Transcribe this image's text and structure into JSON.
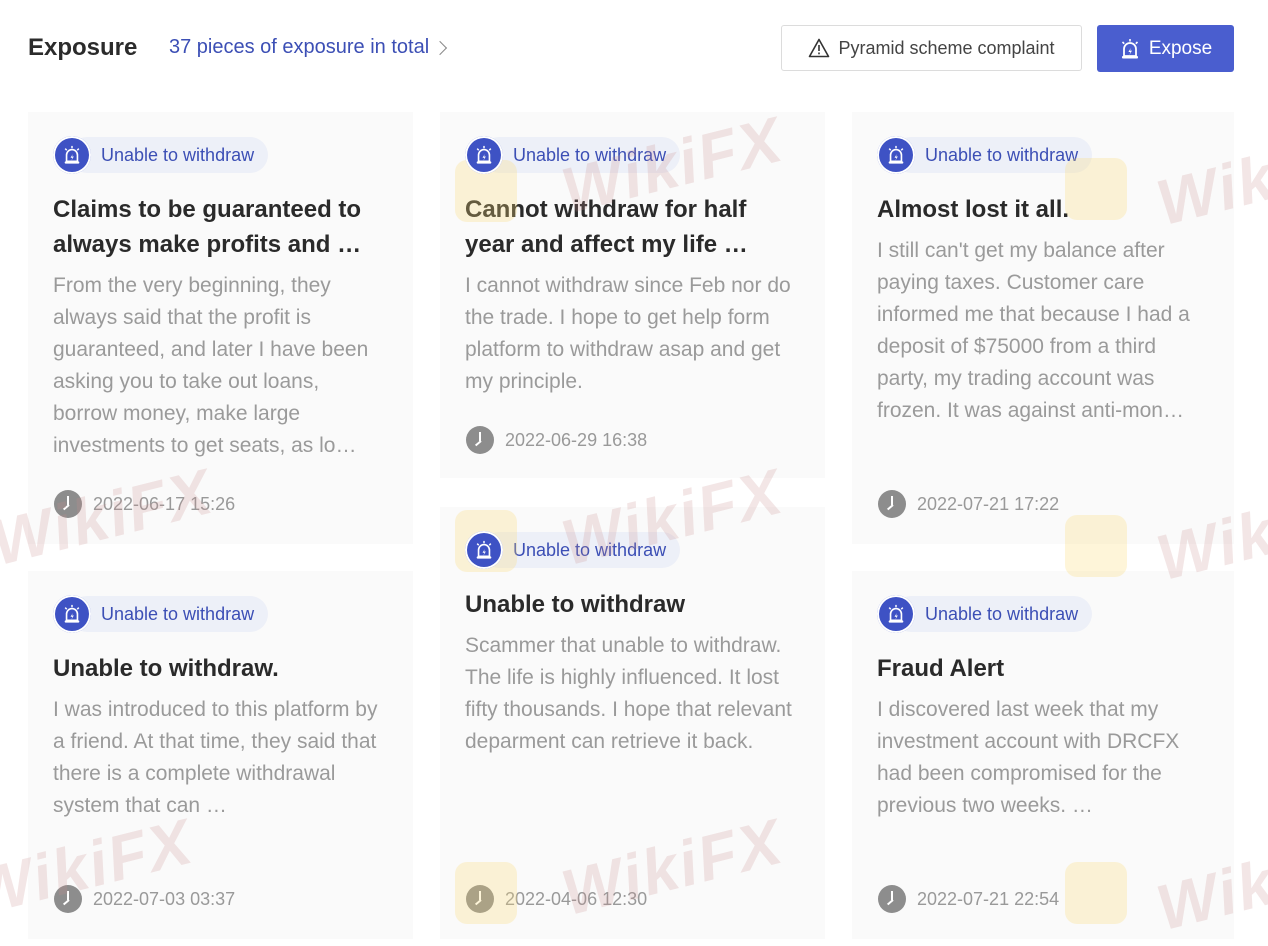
{
  "header": {
    "title": "Exposure",
    "count_link": "37 pieces of exposure in total",
    "complaint_button": "Pyramid scheme complaint",
    "expose_button": "Expose"
  },
  "watermark_text": "WikiFX",
  "cards": [
    {
      "tag": "Unable to withdraw",
      "title": "Claims to be guaranteed to always make profits and …",
      "body": "From the very beginning, they always said that the profit is guaranteed, and later I have been asking you to take out loans, borrow money, make large investments to get seats, as lo…",
      "date": "2022-06-17 15:26"
    },
    {
      "tag": "Unable to withdraw",
      "title": "Cannot withdraw for half year and affect my life …",
      "body": "I cannot withdraw since Feb nor do the trade. I hope to get help form platform to withdraw asap and get my principle.",
      "date": "2022-06-29 16:38"
    },
    {
      "tag": "Unable to withdraw",
      "title": "Almost lost it all.",
      "body": "I still can't get my balance after paying taxes. Customer care informed me that because I had a deposit of $75000 from a third party, my trading account was frozen. It was against anti-mon…",
      "date": "2022-07-21 17:22"
    },
    {
      "tag": "Unable to withdraw",
      "title": "Unable to withdraw.",
      "body": "I was introduced to this platform by a friend. At that time, they said that there is a complete withdrawal system that can …",
      "date": "2022-07-03 03:37"
    },
    {
      "tag": "Unable to withdraw",
      "title": "Unable to withdraw",
      "body": "Scammer that unable to withdraw. The life is highly influenced. It lost fifty thousands. I hope that relevant deparment can retrieve it back.",
      "date": "2022-04-06 12:30"
    },
    {
      "tag": "Unable to withdraw",
      "title": "Fraud Alert",
      "body": "I discovered last week that my investment account with DRCFX had been compromised for the previous two weeks. …",
      "date": "2022-07-21 22:54"
    }
  ],
  "colors": {
    "accent": "#3c4fb5",
    "expose_button_bg": "#4a5ecf",
    "tag_bg": "#edf0f8",
    "card_bg": "#fafafa",
    "body_text": "#9a9a9a"
  }
}
